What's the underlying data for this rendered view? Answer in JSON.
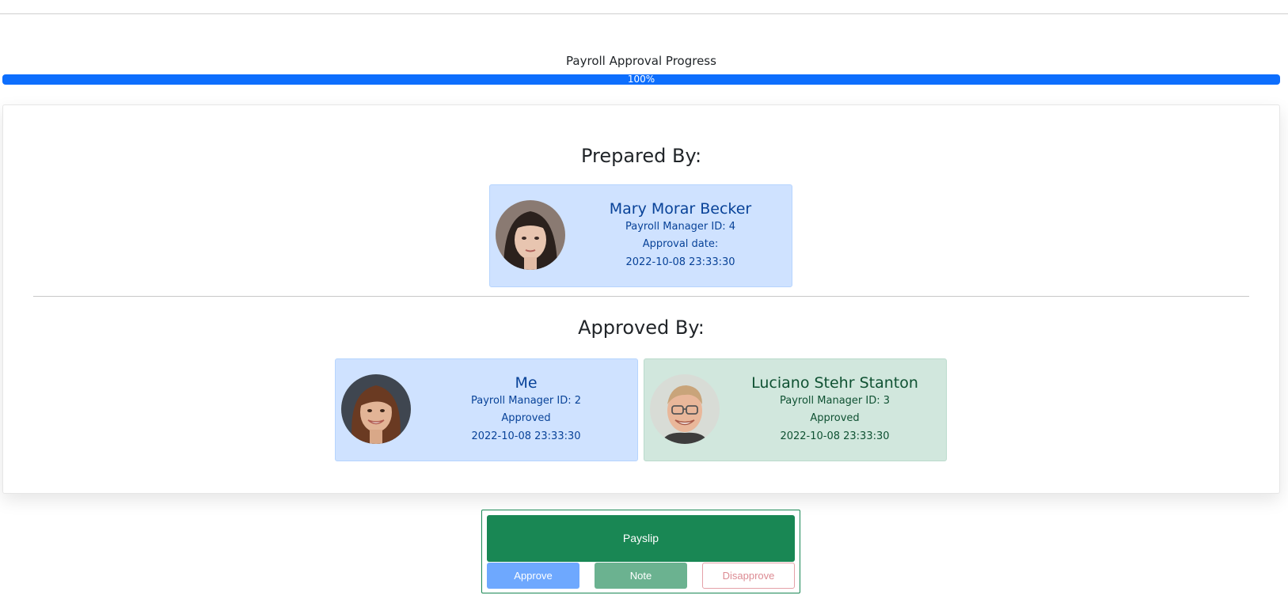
{
  "progress": {
    "title": "Payroll Approval Progress",
    "value": 100,
    "label": "100%",
    "color": "#0d6efd"
  },
  "prepared": {
    "heading": "Prepared By:",
    "person": {
      "name": "Mary Morar Becker",
      "id_line": "Payroll Manager ID: 4",
      "status_line": "Approval date:",
      "date": "2022-10-08 23:33:30",
      "avatar_icon": "person-avatar-icon"
    }
  },
  "approved": {
    "heading": "Approved By:",
    "people": [
      {
        "name": "Me",
        "id_line": "Payroll Manager ID: 2",
        "status_line": "Approved",
        "date": "2022-10-08 23:33:30",
        "card_color": "#cfe2ff"
      },
      {
        "name": "Luciano Stehr Stanton",
        "id_line": "Payroll Manager ID: 3",
        "status_line": "Approved",
        "date": "2022-10-08 23:33:30",
        "card_color": "#d1e7dd"
      }
    ]
  },
  "actions": {
    "payslip_label": "Payslip",
    "approve_label": "Approve",
    "note_label": "Note",
    "disapprove_label": "Disapprove"
  }
}
